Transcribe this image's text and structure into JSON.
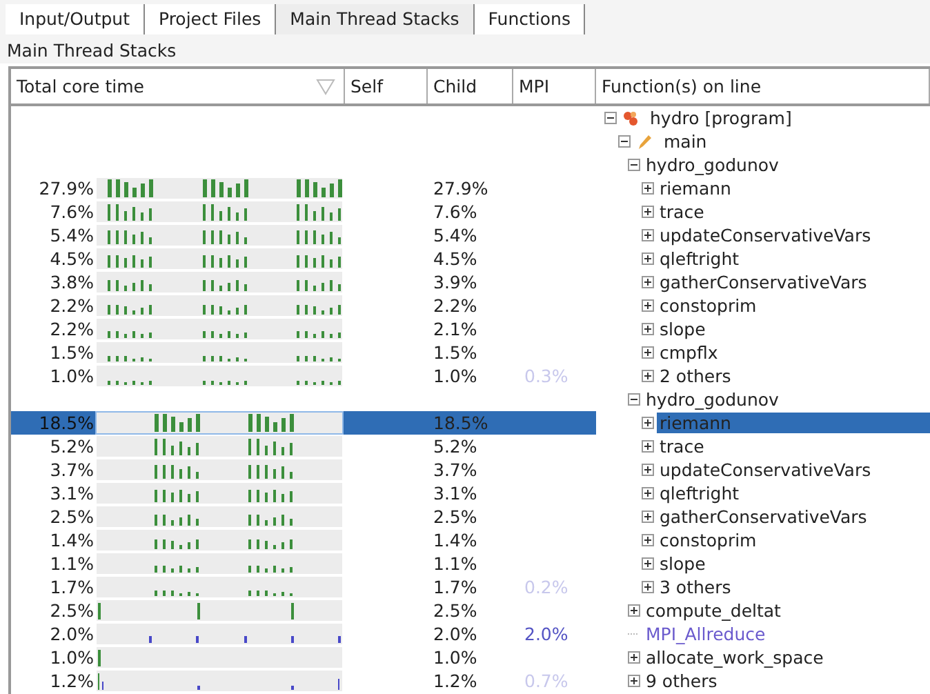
{
  "tabs": [
    {
      "label": "Input/Output",
      "selected": false
    },
    {
      "label": "Project Files",
      "selected": false
    },
    {
      "label": "Main Thread Stacks",
      "selected": true
    },
    {
      "label": "Functions",
      "selected": false
    }
  ],
  "panel_title": "Main Thread Stacks",
  "columns": [
    {
      "label": "Total core time",
      "sorted": true
    },
    {
      "label": "Self",
      "sorted": false
    },
    {
      "label": "Child",
      "sorted": false
    },
    {
      "label": "MPI",
      "sorted": false
    },
    {
      "label": "Function(s) on line",
      "sorted": false
    }
  ],
  "tree": [
    {
      "label": "hydro [program]",
      "kind": "program",
      "expanded": true,
      "selected": false,
      "children": [
        {
          "label": "main",
          "kind": "main",
          "expanded": true,
          "selected": false,
          "children": [
            {
              "label": "hydro_godunov",
              "kind": "call",
              "expanded": true,
              "selected": false,
              "children": [
                {
                  "label": "riemann",
                  "kind": "call",
                  "expanded": false,
                  "selected": false,
                  "total": "27.9%",
                  "child": "27.9%",
                  "activity": {
                    "kind": "bursts3"
                  }
                },
                {
                  "label": "trace",
                  "kind": "call",
                  "expanded": false,
                  "selected": false,
                  "total": "7.6%",
                  "child": "7.6%",
                  "activity": {
                    "kind": "bursts3"
                  }
                },
                {
                  "label": "updateConservativeVars",
                  "kind": "call",
                  "expanded": false,
                  "selected": false,
                  "total": "5.4%",
                  "child": "5.4%",
                  "activity": {
                    "kind": "bursts3"
                  }
                },
                {
                  "label": "qleftright",
                  "kind": "call",
                  "expanded": false,
                  "selected": false,
                  "total": "4.5%",
                  "child": "4.5%",
                  "activity": {
                    "kind": "bursts3"
                  }
                },
                {
                  "label": "gatherConservativeVars",
                  "kind": "call",
                  "expanded": false,
                  "selected": false,
                  "total": "3.8%",
                  "child": "3.9%",
                  "activity": {
                    "kind": "bursts3"
                  }
                },
                {
                  "label": "constoprim",
                  "kind": "call",
                  "expanded": false,
                  "selected": false,
                  "total": "2.2%",
                  "child": "2.2%",
                  "activity": {
                    "kind": "bursts3"
                  }
                },
                {
                  "label": "slope",
                  "kind": "call",
                  "expanded": false,
                  "selected": false,
                  "total": "2.2%",
                  "child": "2.1%",
                  "activity": {
                    "kind": "bursts3"
                  }
                },
                {
                  "label": "cmpflx",
                  "kind": "call",
                  "expanded": false,
                  "selected": false,
                  "total": "1.5%",
                  "child": "1.5%",
                  "activity": {
                    "kind": "bursts3"
                  }
                },
                {
                  "label": "2 others",
                  "kind": "call",
                  "expanded": false,
                  "selected": false,
                  "total": "1.0%",
                  "child": "1.0%",
                  "mpi": "0.3%",
                  "mpi_strong": false,
                  "activity": {
                    "kind": "bursts3"
                  }
                }
              ]
            },
            {
              "label": "hydro_godunov",
              "kind": "call",
              "expanded": true,
              "selected": false,
              "children": [
                {
                  "label": "riemann",
                  "kind": "call",
                  "expanded": false,
                  "selected": true,
                  "total": "18.5%",
                  "child": "18.5%",
                  "activity": {
                    "kind": "bursts2"
                  }
                },
                {
                  "label": "trace",
                  "kind": "call",
                  "expanded": false,
                  "selected": false,
                  "total": "5.2%",
                  "child": "5.2%",
                  "activity": {
                    "kind": "bursts2"
                  }
                },
                {
                  "label": "updateConservativeVars",
                  "kind": "call",
                  "expanded": false,
                  "selected": false,
                  "total": "3.7%",
                  "child": "3.7%",
                  "activity": {
                    "kind": "bursts2"
                  }
                },
                {
                  "label": "qleftright",
                  "kind": "call",
                  "expanded": false,
                  "selected": false,
                  "total": "3.1%",
                  "child": "3.1%",
                  "activity": {
                    "kind": "bursts2"
                  }
                },
                {
                  "label": "gatherConservativeVars",
                  "kind": "call",
                  "expanded": false,
                  "selected": false,
                  "total": "2.5%",
                  "child": "2.5%",
                  "activity": {
                    "kind": "bursts2"
                  }
                },
                {
                  "label": "constoprim",
                  "kind": "call",
                  "expanded": false,
                  "selected": false,
                  "total": "1.4%",
                  "child": "1.4%",
                  "activity": {
                    "kind": "bursts2"
                  }
                },
                {
                  "label": "slope",
                  "kind": "call",
                  "expanded": false,
                  "selected": false,
                  "total": "1.1%",
                  "child": "1.1%",
                  "activity": {
                    "kind": "bursts2"
                  }
                },
                {
                  "label": "3 others",
                  "kind": "call",
                  "expanded": false,
                  "selected": false,
                  "total": "1.7%",
                  "child": "1.7%",
                  "mpi": "0.2%",
                  "mpi_strong": false,
                  "activity": {
                    "kind": "bursts2"
                  }
                }
              ]
            },
            {
              "label": "compute_deltat",
              "kind": "call",
              "expanded": false,
              "selected": false,
              "total": "2.5%",
              "child": "2.5%",
              "activity": {
                "kind": "spikes"
              }
            },
            {
              "label": "MPI_Allreduce",
              "kind": "mpi",
              "selected": false,
              "total": "2.0%",
              "child": "2.0%",
              "mpi": "2.0%",
              "mpi_strong": true,
              "activity": {
                "kind": "mpi"
              }
            },
            {
              "label": "allocate_work_space",
              "kind": "call",
              "expanded": false,
              "selected": false,
              "total": "1.0%",
              "child": "1.0%",
              "activity": {
                "kind": "start"
              }
            },
            {
              "label": "9 others",
              "kind": "call",
              "expanded": false,
              "selected": false,
              "total": "1.2%",
              "child": "1.2%",
              "mpi": "0.7%",
              "mpi_strong": false,
              "activity": {
                "kind": "mixed"
              }
            }
          ]
        }
      ]
    }
  ]
}
